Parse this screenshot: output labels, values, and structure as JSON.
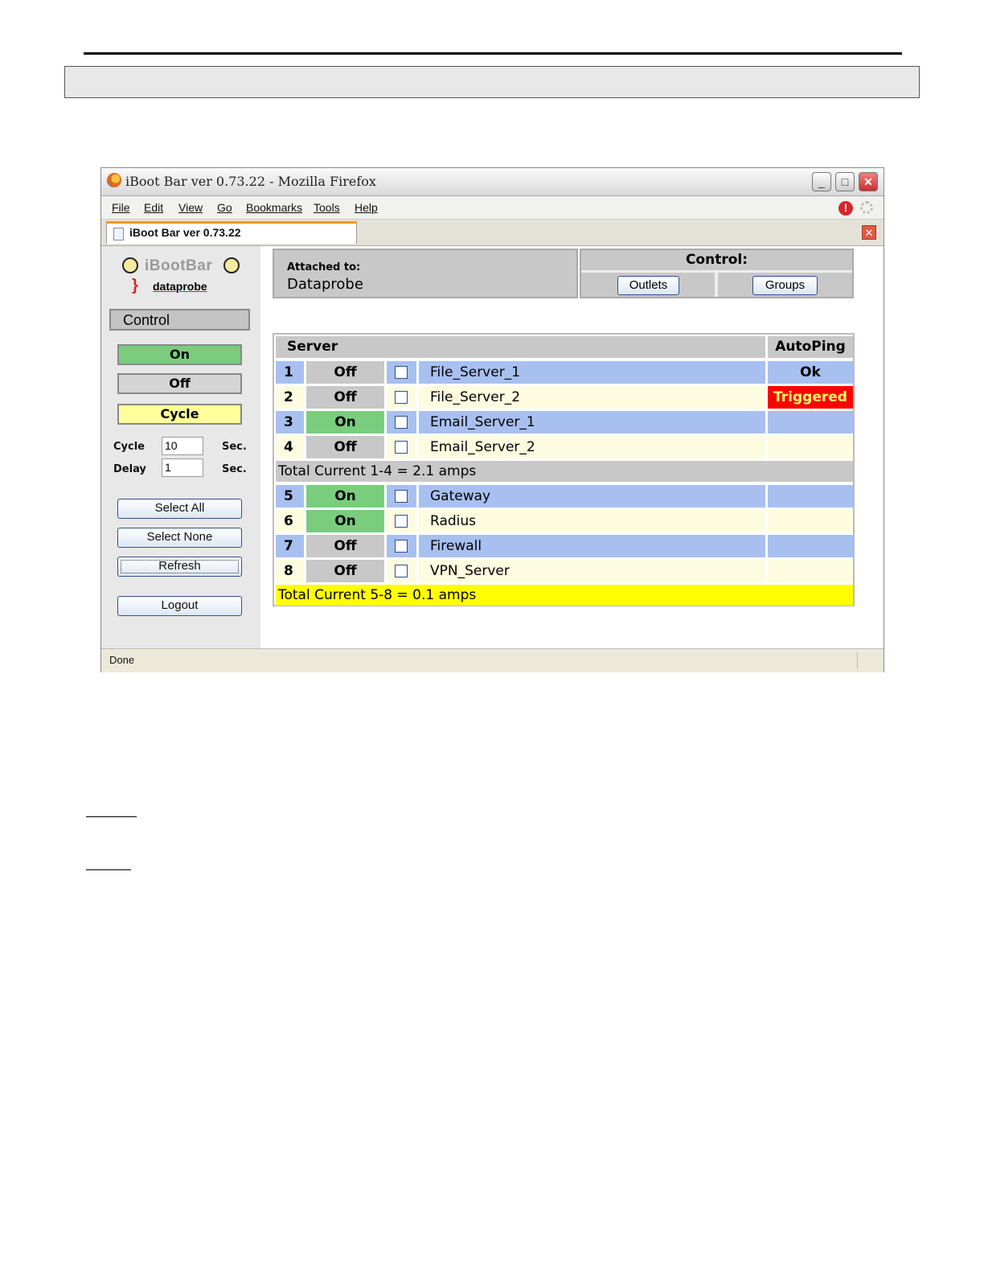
{
  "browser": {
    "title": "iBoot Bar ver 0.73.22 - Mozilla Firefox",
    "menu": [
      "File",
      "Edit",
      "View",
      "Go",
      "Bookmarks",
      "Tools",
      "Help"
    ],
    "tab_label": "iBoot Bar ver 0.73.22",
    "status": "Done",
    "minimize": "_",
    "maximize": "□",
    "close": "✕",
    "stop": "!",
    "tab_close": "✕"
  },
  "logo": {
    "name": "iBootBar",
    "sub": "dataprobe"
  },
  "sidebar": {
    "heading": "Control",
    "on_label": "On",
    "off_label": "Off",
    "cycle_label": "Cycle",
    "cycle_field_label": "Cycle",
    "cycle_value": "10",
    "delay_field_label": "Delay",
    "delay_value": "1",
    "unit": "Sec.",
    "select_all": "Select All",
    "select_none": "Select None",
    "refresh": "Refresh",
    "logout": "Logout"
  },
  "attached": {
    "label": "Attached to:",
    "value": "Dataprobe"
  },
  "control": {
    "title": "Control:",
    "outlets": "Outlets",
    "groups": "Groups"
  },
  "table": {
    "header_server": "Server",
    "header_ping": "AutoPing",
    "rows": [
      {
        "num": "1",
        "state": "Off",
        "name": "File_Server_1",
        "ping": "Ok"
      },
      {
        "num": "2",
        "state": "Off",
        "name": "File_Server_2",
        "ping": "Triggered"
      },
      {
        "num": "3",
        "state": "On",
        "name": "Email_Server_1",
        "ping": ""
      },
      {
        "num": "4",
        "state": "Off",
        "name": "Email_Server_2",
        "ping": ""
      },
      {
        "num": "5",
        "state": "On",
        "name": "Gateway",
        "ping": ""
      },
      {
        "num": "6",
        "state": "On",
        "name": "Radius",
        "ping": ""
      },
      {
        "num": "7",
        "state": "Off",
        "name": "Firewall",
        "ping": ""
      },
      {
        "num": "8",
        "state": "Off",
        "name": "VPN_Server",
        "ping": ""
      }
    ],
    "total_1_4": "Total Current 1-4 = 2.1 amps",
    "total_5_8": "Total Current 5-8 = 0.1 amps"
  },
  "colors": {
    "on": "#79cd7d",
    "off": "#c8c8c8",
    "row_blue": "#a8c0f0",
    "row_cream": "#fdfce0",
    "triggered": "#ff0000",
    "total_highlight": "#ffff00"
  },
  "icons": [
    "firefox-icon",
    "page-icon",
    "stop-icon",
    "throbber-icon",
    "smiley-icon",
    "plug-icon"
  ]
}
